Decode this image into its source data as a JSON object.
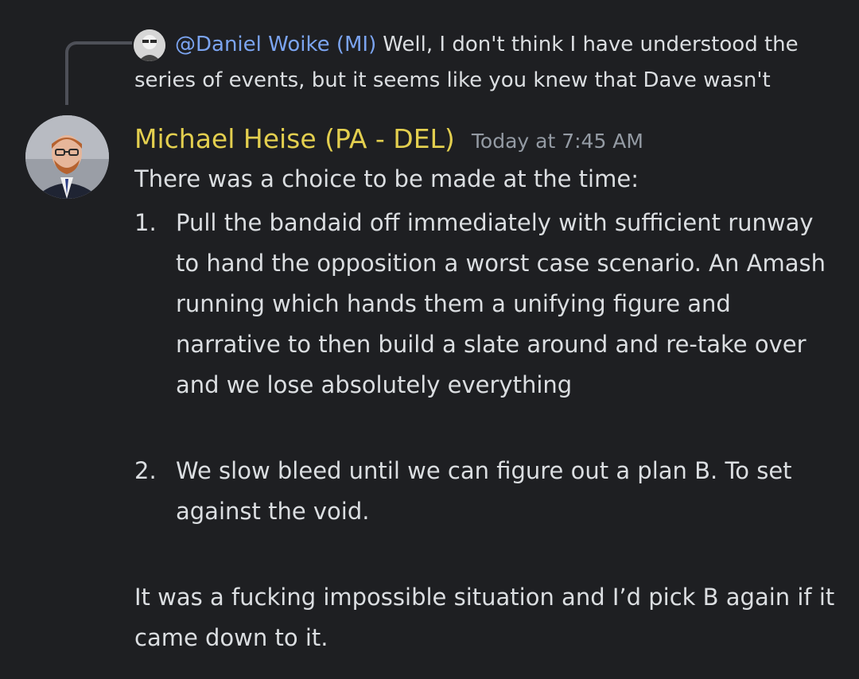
{
  "reply": {
    "mention": "@Daniel Woike (MI)",
    "text": "Well, I don't think I have understood the series of events, but it seems like you knew that Dave wasn't"
  },
  "message": {
    "author": "Michael Heise (PA - DEL)",
    "timestamp": "Today at 7:45 AM",
    "intro": "There was a choice to be made at the time:",
    "items": [
      {
        "number": "1.",
        "text": "Pull the bandaid off immediately with sufficient runway to hand the opposition a worst case scenario. An Amash running which hands them a unifying figure and narrative to then build a slate around and re-take over and we lose absolutely everything"
      },
      {
        "number": "2.",
        "text": "We slow bleed until we can figure out a plan B. To set against the void."
      }
    ],
    "closing": "It was a fucking impossible situation and I’d pick B again if it came down to it."
  },
  "colors": {
    "background": "#1e1f22",
    "text": "#dbdee1",
    "author": "#e3cf4f",
    "mention": "#7ba4f0",
    "timestamp": "#949ba4"
  }
}
